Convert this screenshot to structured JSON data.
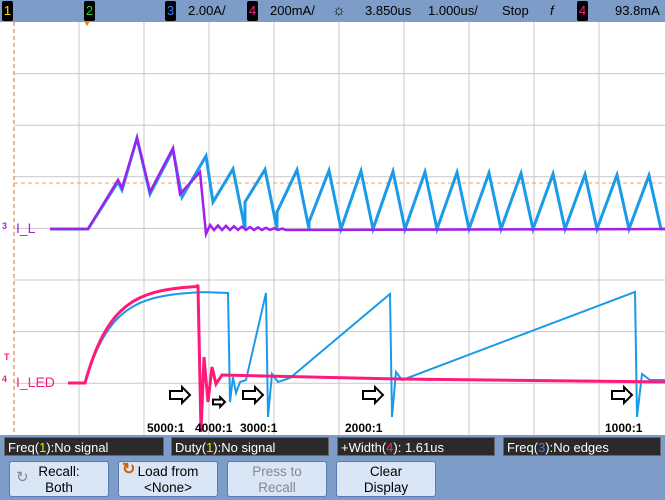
{
  "top_bar": {
    "ch1": "1",
    "ch2": "2",
    "ch3": "3",
    "ch3_scale": "2.00A/",
    "ch4": "4",
    "ch4_scale": "200mA/",
    "trigger_icon": "sun-icon",
    "time_delay": "3.850us",
    "time_scale": "1.000us/",
    "run_state": "Stop",
    "trigger_edge_icon": "falling-edge-icon",
    "trigger_source": "4",
    "trigger_level": "93.8mA",
    "colors": {
      "ch1": "#f0e000",
      "ch2": "#30d030",
      "ch3": "#3080ff",
      "ch4": "#ff2080"
    }
  },
  "traces": {
    "ch3_label": "I_L",
    "ch3_marker": "3",
    "ch4_label": "I_LED",
    "ch4_marker": "4",
    "trigger_marker": "T",
    "colors": {
      "il_blue": "#1a9be8",
      "il_purple": "#a020f0",
      "iled_pink": "#ff1a7a",
      "iled_blue": "#1a9be8"
    }
  },
  "annotations": [
    "5000:1",
    "4000:1",
    "3000:1",
    "2000:1",
    "1000:1"
  ],
  "measurements": [
    {
      "prefix": "Freq(",
      "ch": "1",
      "suffix": "):No signal"
    },
    {
      "prefix": "Duty(",
      "ch": "1",
      "suffix": "):No signal"
    },
    {
      "prefix": "+Width(",
      "ch": "4",
      "suffix": "): 1.61us"
    },
    {
      "prefix": "Freq(",
      "ch": "3",
      "suffix": "):No edges"
    }
  ],
  "softkeys": [
    {
      "line1": "Recall:",
      "line2": "Both",
      "icon": "undo-icon"
    },
    {
      "line1": "Load from",
      "line2": "<None>",
      "icon": "reload-icon"
    },
    {
      "line1": "Press to",
      "line2": "Recall"
    },
    {
      "line1": "Clear",
      "line2": "Display"
    }
  ]
}
